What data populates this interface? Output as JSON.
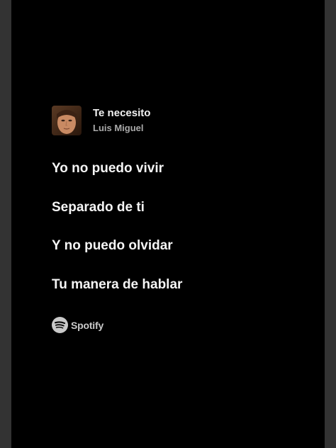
{
  "track": {
    "title": "Te necesito",
    "artist": "Luis Miguel"
  },
  "lyrics": [
    "Yo no puedo vivir",
    "Separado de ti",
    "Y no puedo olvidar",
    "Tu manera de hablar"
  ],
  "brand": {
    "name": "Spotify",
    "icon": "spotify-logo-icon"
  },
  "colors": {
    "background": "#000000",
    "frame": "#333333",
    "lyric_text": "#f5f5f5",
    "artist_text": "#a9a9a9"
  }
}
